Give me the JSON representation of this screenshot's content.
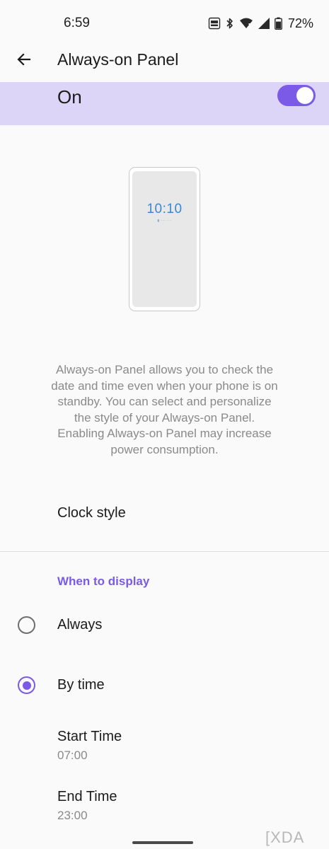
{
  "status_bar": {
    "time": "6:59",
    "battery_percent": "72%",
    "icons": [
      "refresh-rate-120hz-icon",
      "bluetooth-icon",
      "wifi-icon",
      "cellular-signal-icon",
      "battery-icon"
    ]
  },
  "header": {
    "title": "Always-on Panel",
    "back_icon": "arrow-left-icon"
  },
  "master_switch": {
    "label": "On",
    "checked": true
  },
  "preview": {
    "clock": "10:10"
  },
  "description": "Always-on Panel allows you to check the date and time even when your phone is on standby. You can select and personalize the style of your Always-on Panel. Enabling Always-on Panel may increase power consumption.",
  "clock_style": {
    "label": "Clock style"
  },
  "when_to_display": {
    "header": "When to display",
    "options": [
      {
        "label": "Always",
        "selected": false
      },
      {
        "label": "By time",
        "selected": true
      }
    ]
  },
  "start_time": {
    "label": "Start Time",
    "value": "07:00"
  },
  "end_time": {
    "label": "End Time",
    "value": "23:00"
  },
  "watermark": "XDA",
  "colors": {
    "accent": "#7a5ae6",
    "master_bg": "#dcd5f8",
    "clock_blue": "#3b86d6",
    "secondary_text": "#8a8a8a"
  }
}
